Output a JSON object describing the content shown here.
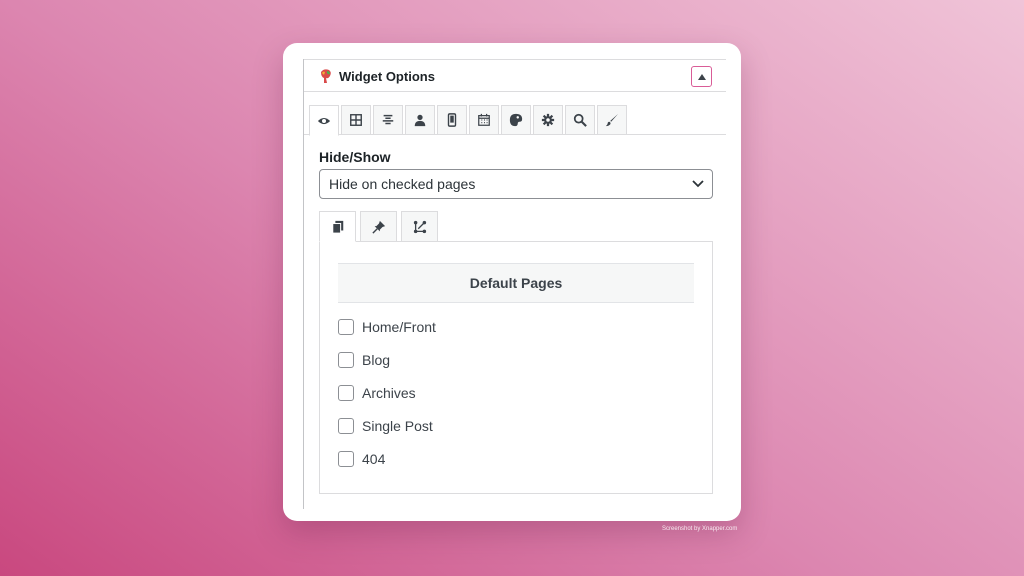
{
  "panel": {
    "title": "Widget Options",
    "collapse_icon": "triangle-up-icon"
  },
  "tabs": [
    {
      "icon": "eye-icon",
      "active": true
    },
    {
      "icon": "grid-icon",
      "active": false
    },
    {
      "icon": "align-center-icon",
      "active": false
    },
    {
      "icon": "user-icon",
      "active": false
    },
    {
      "icon": "mobile-icon",
      "active": false
    },
    {
      "icon": "calendar-icon",
      "active": false
    },
    {
      "icon": "palette-icon",
      "active": false
    },
    {
      "icon": "gear-icon",
      "active": false
    },
    {
      "icon": "magnifier-icon",
      "active": false
    },
    {
      "icon": "brush-icon",
      "active": false
    }
  ],
  "visibility": {
    "label": "Hide/Show",
    "selected": "Hide on checked pages"
  },
  "subtabs": [
    {
      "icon": "pages-icon",
      "active": true
    },
    {
      "icon": "pin-icon",
      "active": false
    },
    {
      "icon": "taxonomy-icon",
      "active": false
    }
  ],
  "default_pages": {
    "heading": "Default Pages",
    "items": [
      {
        "label": "Home/Front",
        "checked": false
      },
      {
        "label": "Blog",
        "checked": false
      },
      {
        "label": "Archives",
        "checked": false
      },
      {
        "label": "Single Post",
        "checked": false
      },
      {
        "label": "404",
        "checked": false
      }
    ]
  },
  "watermark": "Screenshot by Xnapper.com",
  "colors": {
    "accent": "#d95c97",
    "border": "#dcdcde",
    "text": "#1d2327"
  }
}
